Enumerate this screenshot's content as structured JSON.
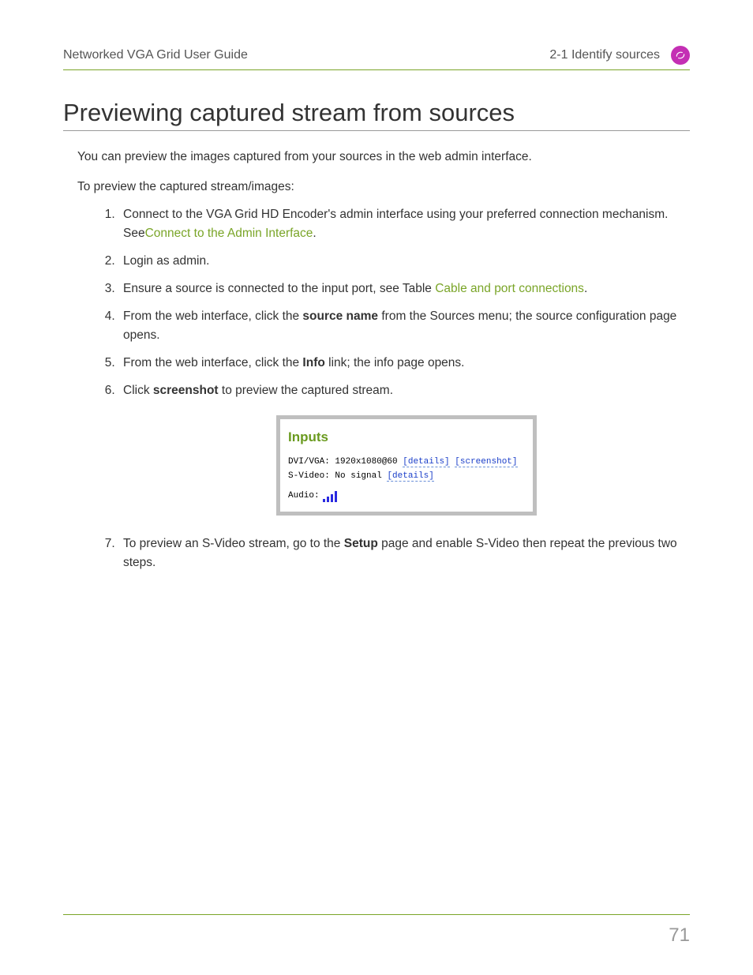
{
  "header": {
    "left": "Networked VGA Grid User Guide",
    "right": "2-1 Identify sources"
  },
  "title": "Previewing captured stream from sources",
  "intro": "You can preview the images captured from your sources in the web admin interface.",
  "lead": "To preview the captured stream/images:",
  "steps": {
    "s1_a": "Connect to the VGA Grid HD Encoder's admin interface using your preferred connection mechanism. See",
    "s1_link": "Connect to the Admin Interface",
    "s1_b": ".",
    "s2": "Login as admin.",
    "s3_a": "Ensure a source is connected to the input port, see Table ",
    "s3_link": "Cable and port connections",
    "s3_b": ".",
    "s4_a": "From the web interface, click the ",
    "s4_bold": "source name",
    "s4_b": " from the Sources menu; the source configuration page opens.",
    "s5_a": "From the web interface, click the ",
    "s5_bold": "Info",
    "s5_b": " link; the info page opens.",
    "s6_a": "Click ",
    "s6_bold": "screenshot",
    "s6_b": " to preview the captured stream.",
    "s7_a": "To preview an S-Video stream, go to the ",
    "s7_bold": "Setup",
    "s7_b": " page and enable S-Video then repeat the previous two steps."
  },
  "inputs_box": {
    "title": "Inputs",
    "row1_label": "DVI/VGA: ",
    "row1_value": "1920x1080@60 ",
    "row1_link1": "[details]",
    "row1_link2": "[screenshot]",
    "row2_label": "S-Video: ",
    "row2_value": "No signal ",
    "row2_link1": "[details]",
    "audio_label": "Audio: "
  },
  "page_number": "71"
}
